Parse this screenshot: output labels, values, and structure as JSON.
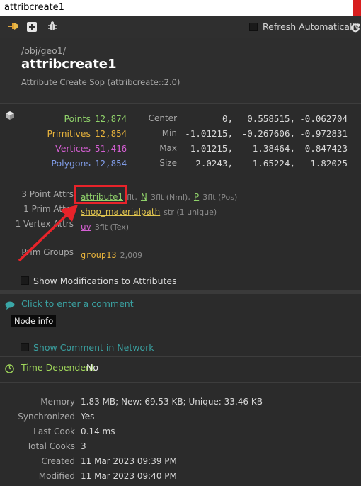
{
  "window": {
    "title": "attribcreate1"
  },
  "toolbar": {
    "refresh_label": "Refresh Automatically"
  },
  "node": {
    "path": "/obj/geo1/",
    "name": "attribcreate1",
    "type_label": "Attribute Create Sop (attribcreate::2.0)"
  },
  "counts": [
    {
      "label": "Points",
      "value": "12,874",
      "color": "#8fd16a"
    },
    {
      "label": "Primitives",
      "value": "12,854",
      "color": "#e6b23c"
    },
    {
      "label": "Vertices",
      "value": "51,416",
      "color": "#d55fd3"
    },
    {
      "label": "Polygons",
      "value": "12,854",
      "color": "#7f9be6"
    }
  ],
  "bounds": [
    {
      "label": "Center",
      "v": [
        "0,",
        "0.558515,",
        "-0.062704"
      ]
    },
    {
      "label": "Min",
      "v": [
        "-1.01215,",
        "-0.267606,",
        "-0.972831"
      ]
    },
    {
      "label": "Max",
      "v": [
        "1.01215,",
        "1.38464,",
        "0.847423"
      ]
    },
    {
      "label": "Size",
      "v": [
        "2.0243,",
        "1.65224,",
        "1.82025"
      ]
    }
  ],
  "attrs": {
    "point_label": "3 Point Attrs",
    "point_items": [
      {
        "name": "attribute1",
        "desc": "flt",
        "sep": ","
      },
      {
        "name": "N",
        "desc": "3flt (Nml)",
        "sep": ","
      },
      {
        "name": "P",
        "desc": "3flt (Pos)",
        "sep": ""
      }
    ],
    "prim_label": "1 Prim Attrs",
    "prim_name": "shop_materialpath",
    "prim_desc": "str (1 unique)",
    "vertex_label": "1 Vertex Attrs",
    "vertex_name": "uv",
    "vertex_desc": "3flt (Tex)",
    "groups_label": "Prim Groups",
    "groups_name": "group13",
    "groups_count": "2,009"
  },
  "show_mods_label": "Show Modifications to Attributes",
  "comment": {
    "placeholder": "Click to enter a comment",
    "tooltip": "Node info",
    "show_in_network_label": "Show Comment in Network"
  },
  "time_dependent": {
    "label": "Time Dependent",
    "value": "No"
  },
  "stats": [
    {
      "label": "Memory",
      "value": "1.83 MB; New: 69.53 KB; Unique: 33.46 KB"
    },
    {
      "label": "Synchronized",
      "value": "Yes"
    },
    {
      "label": "Last Cook",
      "value": "0.14 ms"
    },
    {
      "label": "Total Cooks",
      "value": "3"
    },
    {
      "label": "Created",
      "value": "11 Mar 2023 09:39 PM"
    },
    {
      "label": "Modified",
      "value": "11 Mar 2023 09:40 PM"
    }
  ],
  "colors": {
    "annotation": "#e8232a",
    "attr_link": "#e0c44e",
    "point_attr": "#8fd16a",
    "comment_icon": "#3aa7a7"
  }
}
